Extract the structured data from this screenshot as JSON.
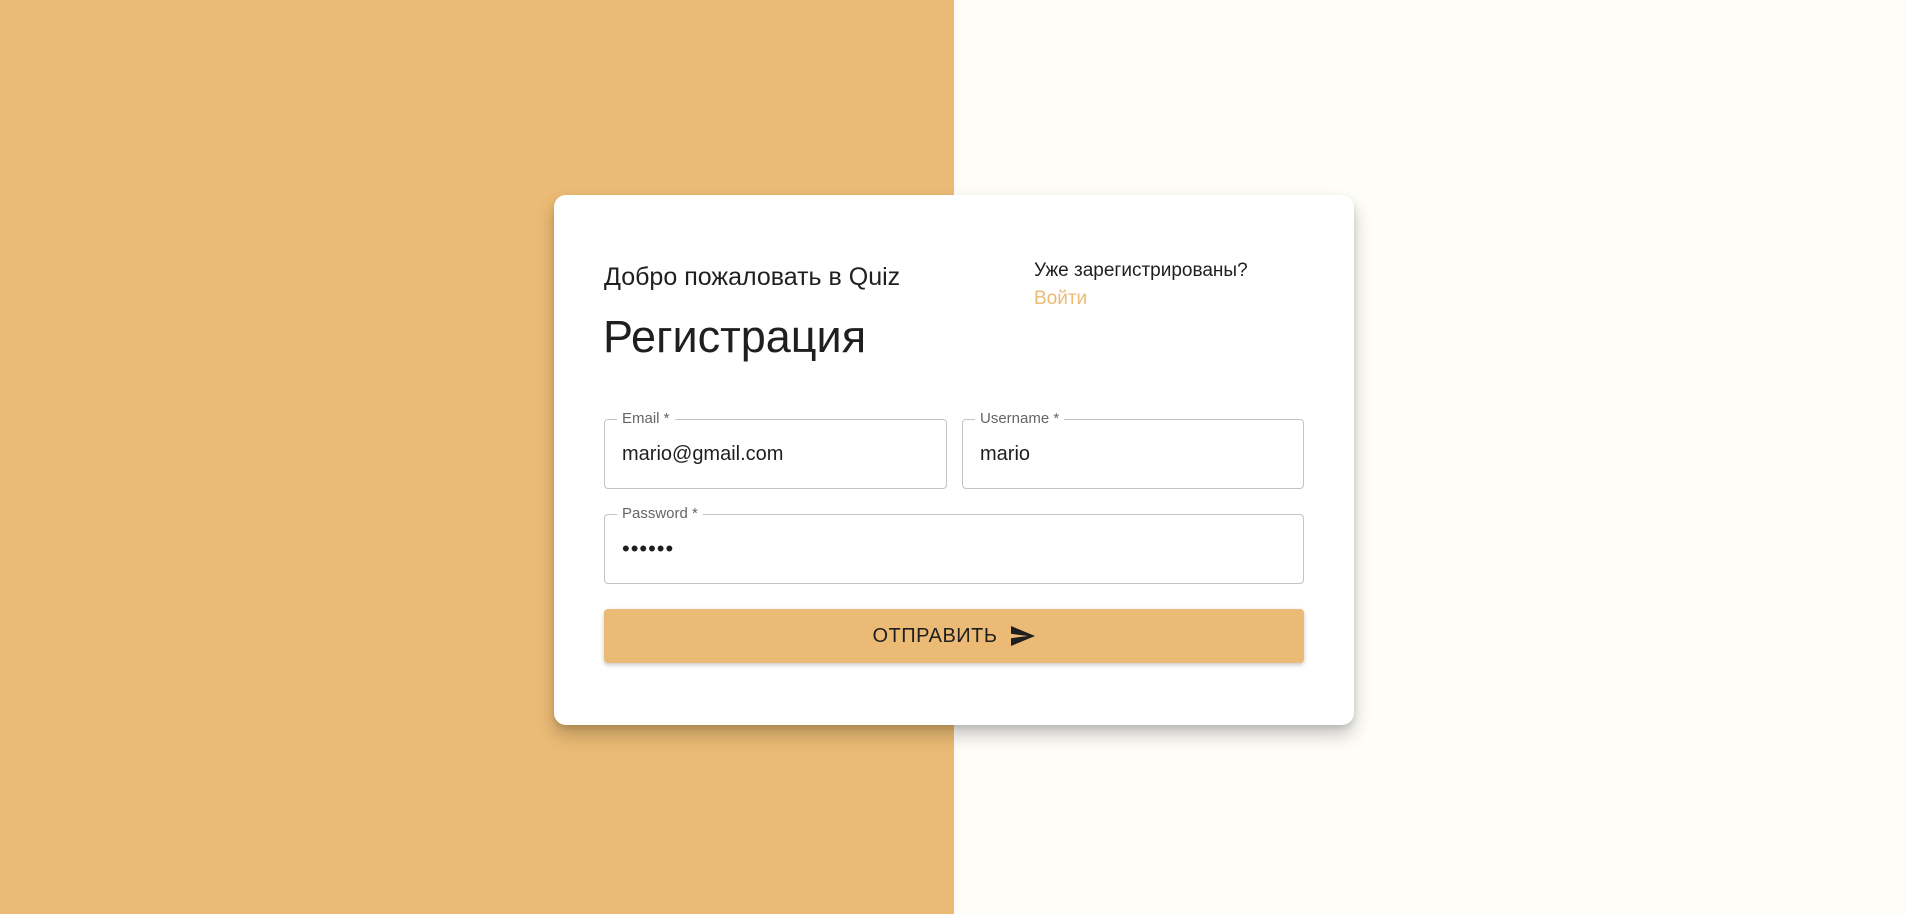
{
  "header": {
    "welcome": "Добро пожаловать в Quiz",
    "title": "Регистрация",
    "already_registered": "Уже зарегистрированы?",
    "login_link": "Войти"
  },
  "form": {
    "email": {
      "label": "Email *",
      "value": "mario@gmail.com"
    },
    "username": {
      "label": "Username *",
      "value": "mario"
    },
    "password": {
      "label": "Password *",
      "value": "pass12"
    },
    "submit_label": "ОТПРАВИТЬ",
    "submit_icon": "send-icon"
  },
  "colors": {
    "accent": "#ebbb75",
    "right_background": "#fffdf8",
    "text": "#1f1f1f"
  }
}
